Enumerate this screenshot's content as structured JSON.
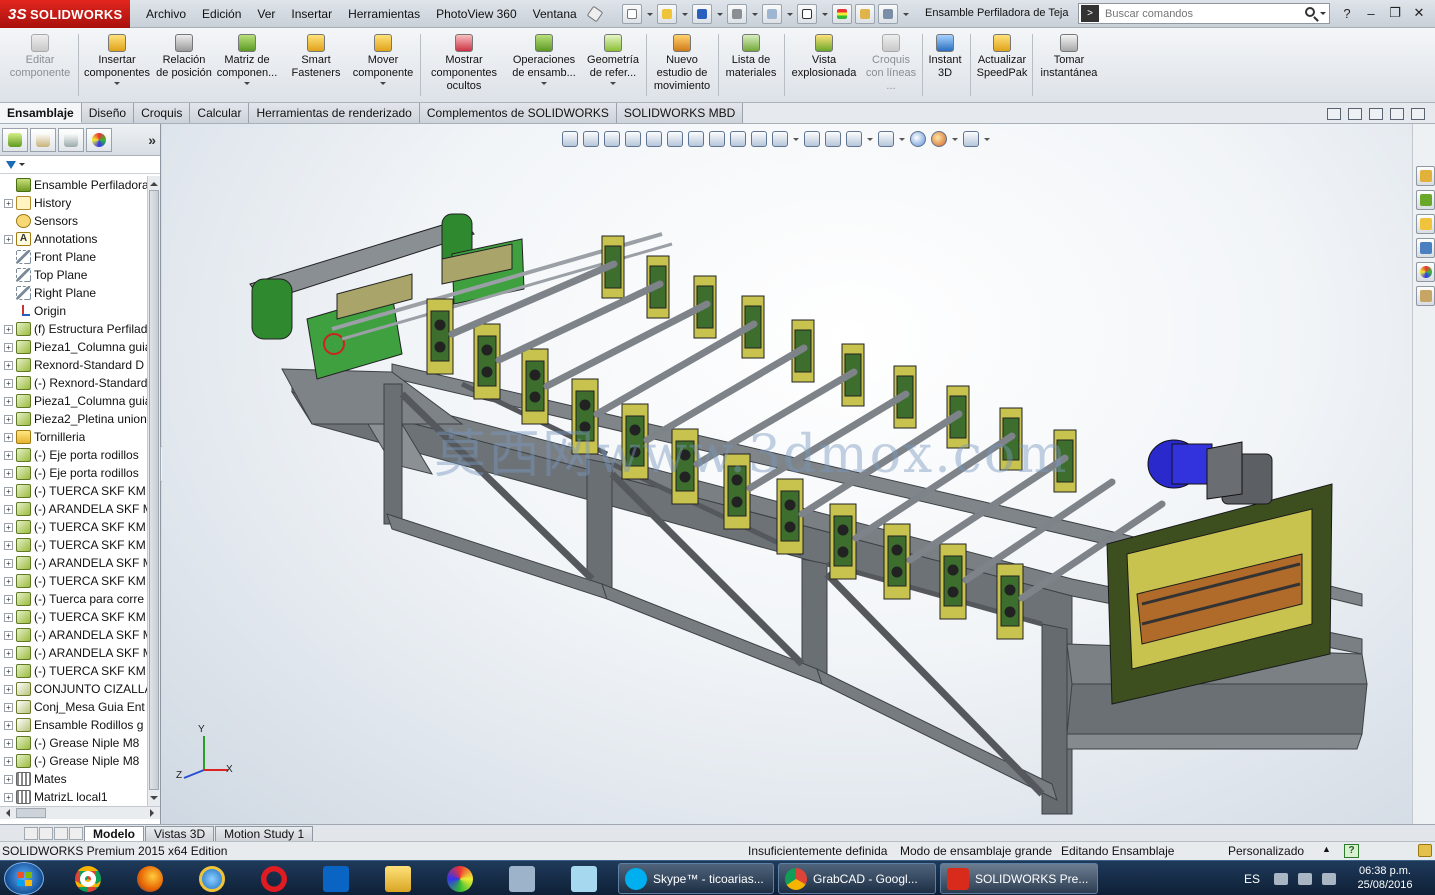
{
  "app": {
    "brand": "SOLIDWORKS",
    "brand_mark": "3S",
    "document_title": "Ensamble Perfiladora de Teja"
  },
  "menu": [
    "Archivo",
    "Edición",
    "Ver",
    "Insertar",
    "Herramientas",
    "PhotoView 360",
    "Ventana"
  ],
  "search": {
    "placeholder": "Buscar comandos"
  },
  "window_controls": [
    "?",
    "–",
    "❐",
    "✕"
  ],
  "command_manager": [
    {
      "label": "Editar componente",
      "enabled": false
    },
    {
      "label": "Insertar componentes",
      "enabled": true
    },
    {
      "label": "Relación de posición",
      "enabled": true
    },
    {
      "label": "Matriz de componen...",
      "enabled": true
    },
    {
      "label": "Smart Fasteners",
      "enabled": true
    },
    {
      "label": "Mover componente",
      "enabled": true
    },
    {
      "label": "Mostrar componentes ocultos",
      "enabled": true
    },
    {
      "label": "Operaciones de ensamb...",
      "enabled": true
    },
    {
      "label": "Geometría de refer...",
      "enabled": true
    },
    {
      "label": "Nuevo estudio de movimiento",
      "enabled": true
    },
    {
      "label": "Lista de materiales",
      "enabled": true
    },
    {
      "label": "Vista explosionada",
      "enabled": true
    },
    {
      "label": "Croquis con líneas ...",
      "enabled": false
    },
    {
      "label": "Instant 3D",
      "enabled": true
    },
    {
      "label": "Actualizar SpeedPak",
      "enabled": true
    },
    {
      "label": "Tomar instantánea",
      "enabled": true
    }
  ],
  "tabs": [
    "Ensamblaje",
    "Diseño",
    "Croquis",
    "Calcular",
    "Herramientas de renderizado",
    "Complementos de SOLIDWORKS",
    "SOLIDWORKS MBD"
  ],
  "panel": {
    "more": "»"
  },
  "tree": [
    {
      "label": "Ensamble Perfiladora de Teja",
      "icon": "assembly-root"
    },
    {
      "label": "History",
      "icon": "history"
    },
    {
      "label": "Sensors",
      "icon": "sensors"
    },
    {
      "label": "Annotations",
      "icon": "annotations"
    },
    {
      "label": "Front Plane",
      "icon": "plane"
    },
    {
      "label": "Top Plane",
      "icon": "plane"
    },
    {
      "label": "Right Plane",
      "icon": "plane"
    },
    {
      "label": "Origin",
      "icon": "origin"
    },
    {
      "label": "(f) Estructura Perfiladora",
      "icon": "part"
    },
    {
      "label": "Pieza1_Columna guia",
      "icon": "part"
    },
    {
      "label": "Rexnord-Standard D",
      "icon": "part"
    },
    {
      "label": "(-) Rexnord-Standard",
      "icon": "part"
    },
    {
      "label": "Pieza1_Columna guia",
      "icon": "part"
    },
    {
      "label": "Pieza2_Pletina union",
      "icon": "part"
    },
    {
      "label": "Tornilleria",
      "icon": "folder"
    },
    {
      "label": "(-) Eje porta rodillos",
      "icon": "part"
    },
    {
      "label": "(-) Eje porta rodillos",
      "icon": "part"
    },
    {
      "label": "(-) TUERCA SKF KM",
      "icon": "part"
    },
    {
      "label": "(-) ARANDELA SKF M",
      "icon": "part"
    },
    {
      "label": "(-) TUERCA SKF KM",
      "icon": "part"
    },
    {
      "label": "(-) TUERCA SKF KM",
      "icon": "part"
    },
    {
      "label": "(-) ARANDELA SKF M",
      "icon": "part"
    },
    {
      "label": "(-) TUERCA SKF KM",
      "icon": "part"
    },
    {
      "label": "(-) Tuerca para corre",
      "icon": "part"
    },
    {
      "label": "(-) TUERCA SKF KM",
      "icon": "part"
    },
    {
      "label": "(-) ARANDELA SKF M",
      "icon": "part"
    },
    {
      "label": "(-) ARANDELA SKF M",
      "icon": "part"
    },
    {
      "label": "(-) TUERCA SKF KM",
      "icon": "part"
    },
    {
      "label": "CONJUNTO CIZALLA",
      "icon": "assembly"
    },
    {
      "label": "Conj_Mesa Guia Ent",
      "icon": "assembly"
    },
    {
      "label": "Ensamble Rodillos g",
      "icon": "assembly"
    },
    {
      "label": "(-) Grease Niple M8",
      "icon": "part"
    },
    {
      "label": "(-) Grease Niple M8",
      "icon": "part"
    },
    {
      "label": "Mates",
      "icon": "mates"
    },
    {
      "label": "MatrizL local1",
      "icon": "pattern"
    }
  ],
  "graphics": {
    "watermark": "莫西网www.3dmox.com",
    "triad": {
      "x": "X",
      "y": "Y",
      "z": "Z"
    }
  },
  "bottom_tabs": [
    "Modelo",
    "Vistas 3D",
    "Motion Study 1"
  ],
  "status": {
    "product": "SOLIDWORKS Premium 2015 x64 Edition",
    "definition": "Insuficientemente definida",
    "mode": "Modo de ensamblaje grande",
    "editing": "Editando Ensamblaje",
    "custom": "Personalizado",
    "custom_caret": "▲",
    "help": "?"
  },
  "taskbar": {
    "windows": [
      {
        "label": "Skype™ - ticoarias...",
        "color": "#00aff0"
      },
      {
        "label": "GrabCAD - Googl...",
        "color": "#db4437"
      },
      {
        "label": "SOLIDWORKS Pre...",
        "color": "#d92b1c"
      }
    ],
    "language": "ES",
    "time": "06:38 p.m.",
    "date": "25/08/2016"
  },
  "colors": {
    "frame": "#6f7478",
    "roller_housing": "#c8c24e",
    "bearing_block": "#3d6e2e",
    "cutter": "#3e4f1f",
    "motor": "#2a2acc"
  }
}
